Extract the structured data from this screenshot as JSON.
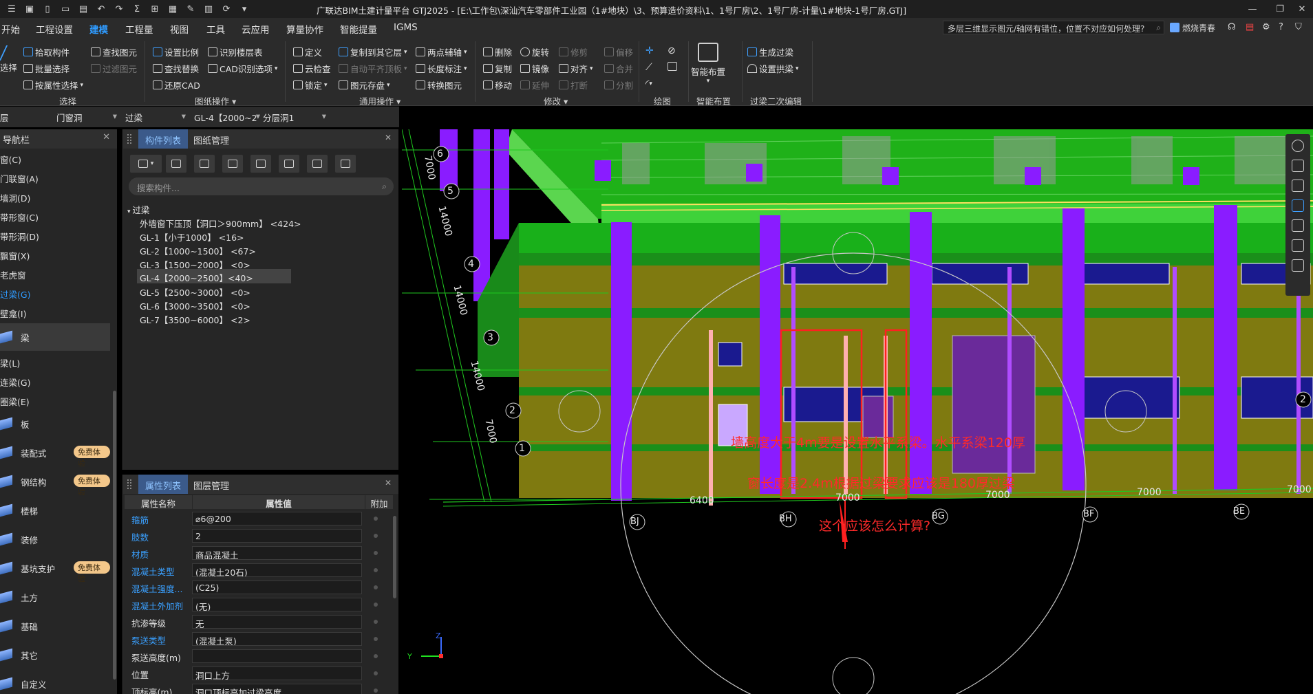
{
  "window": {
    "title": "广联达BIM土建计量平台 GTJ2025 - [E:\\工作包\\深汕汽车零部件工业园（1#地块）\\3、预算造价资料\\1、1号厂房\\2、1号厂房-计量\\1#地块-1号厂房.GTJ]"
  },
  "menu": {
    "items": [
      "开始",
      "工程设置",
      "建模",
      "工程量",
      "视图",
      "工具",
      "云应用",
      "算量协作",
      "智能提量",
      "IGMS"
    ],
    "active": "建模",
    "help_search": "多层三维显示图元/轴网有错位，位置不对应如何处理?",
    "user": "燃烧青春"
  },
  "ribbon": {
    "select_group": {
      "label": "选择",
      "big": "选择",
      "items": [
        "拾取构件",
        "批量选择",
        "按属性选择",
        "查找图元",
        "过滤图元"
      ]
    },
    "drawing_group": {
      "label": "图纸操作",
      "items": [
        "设置比例",
        "识别楼层表",
        "查找替换",
        "CAD识别选项",
        "还原CAD"
      ]
    },
    "common_group": {
      "label": "通用操作",
      "items": [
        "定义",
        "复制到其它层",
        "两点辅轴",
        "云检查",
        "自动平齐顶板",
        "长度标注",
        "锁定",
        "图元存盘",
        "转换图元"
      ]
    },
    "modify_group": {
      "label": "修改",
      "items": [
        "删除",
        "旋转",
        "修剪",
        "偏移",
        "复制",
        "镜像",
        "对齐",
        "合并",
        "移动",
        "延伸",
        "打断",
        "分割"
      ]
    },
    "draw_group": {
      "label": "绘图"
    },
    "smart_group": {
      "label": "智能布置",
      "big": "智能布置"
    },
    "edit_group": {
      "label": "过梁二次编辑",
      "items": [
        "生成过梁",
        "设置拱梁"
      ]
    }
  },
  "selectors": [
    "层",
    "门窗洞",
    "过梁",
    "GL-4【2000~2",
    "分层洞1"
  ],
  "nav": {
    "title": "导航栏",
    "rows": [
      "窗(C)",
      "门联窗(A)",
      "墙洞(D)",
      "带形窗(C)",
      "带形洞(D)",
      "飘窗(X)",
      "老虎窗",
      "过梁(G)",
      "壁龛(I)"
    ],
    "active_row": "过梁(G)",
    "cat_beam": "梁",
    "beam_rows": [
      "梁(L)",
      "连梁(G)",
      "圈梁(E)"
    ],
    "cats": [
      "板",
      "装配式",
      "钢结构",
      "楼梯",
      "装修",
      "基坑支护",
      "土方",
      "基础",
      "其它",
      "自定义"
    ],
    "badge": "免费体验"
  },
  "component_panel": {
    "tabs": [
      "构件列表",
      "图纸管理"
    ],
    "search_placeholder": "搜索构件...",
    "root": "过梁",
    "items": [
      "外墙窗下压顶【洞口＞900mm】 <424>",
      "GL-1【小于1000】 <16>",
      "GL-2【1000~1500】 <67>",
      "GL-3【1500~2000】 <0>",
      "GL-4【2000~2500】<40>",
      "GL-5【2500~3000】 <0>",
      "GL-6【3000~3500】 <0>",
      "GL-7【3500~6000】 <2>"
    ],
    "active_index": 4
  },
  "property_panel": {
    "tabs": [
      "属性列表",
      "图层管理"
    ],
    "headers": [
      "属性名称",
      "属性值",
      "附加"
    ],
    "rows": [
      {
        "name": "箍筋",
        "value": "⌀6@200",
        "blue": true
      },
      {
        "name": "肢数",
        "value": "2",
        "blue": true
      },
      {
        "name": "材质",
        "value": "商品混凝土",
        "blue": true
      },
      {
        "name": "混凝土类型",
        "value": "(混凝土20石)",
        "blue": true
      },
      {
        "name": "混凝土强度...",
        "value": "(C25)",
        "blue": true
      },
      {
        "name": "混凝土外加剂",
        "value": "(无)",
        "blue": true
      },
      {
        "name": "抗渗等级",
        "value": "无",
        "blue": false
      },
      {
        "name": "泵送类型",
        "value": "(混凝土泵)",
        "blue": true
      },
      {
        "name": "泵送高度(m)",
        "value": "",
        "blue": false
      },
      {
        "name": "位置",
        "value": "洞口上方",
        "blue": false
      },
      {
        "name": "顶标高(m)",
        "value": "洞口顶标高加过梁高度",
        "blue": false
      }
    ]
  },
  "viewport": {
    "axis_nums": [
      "6",
      "5",
      "4",
      "3",
      "2",
      "1"
    ],
    "dims_left": [
      "7000",
      "14000",
      "14000",
      "14000",
      "7000"
    ],
    "axis_letters": [
      "BJ",
      "BH",
      "BG",
      "BF",
      "BE"
    ],
    "dims_bottom": [
      "6400",
      "7000",
      "7000",
      "7000",
      "7000"
    ],
    "right_axis": "2",
    "annotation_lines": [
      "墙高度大于4m要是设置水平系梁。水平系梁120厚",
      "窗长度是2.4m根据过梁要求应该是180厚过梁",
      "这个应该怎么计算?"
    ],
    "annotation_color": "#ff2a2a",
    "triad": {
      "y": "Y",
      "z": "Z"
    }
  },
  "colors": {
    "accent": "#2f9bff",
    "wall": "#7f7a10",
    "column": "#8a1cff",
    "slab": "#22c41c",
    "window": "#1a1a8f"
  }
}
